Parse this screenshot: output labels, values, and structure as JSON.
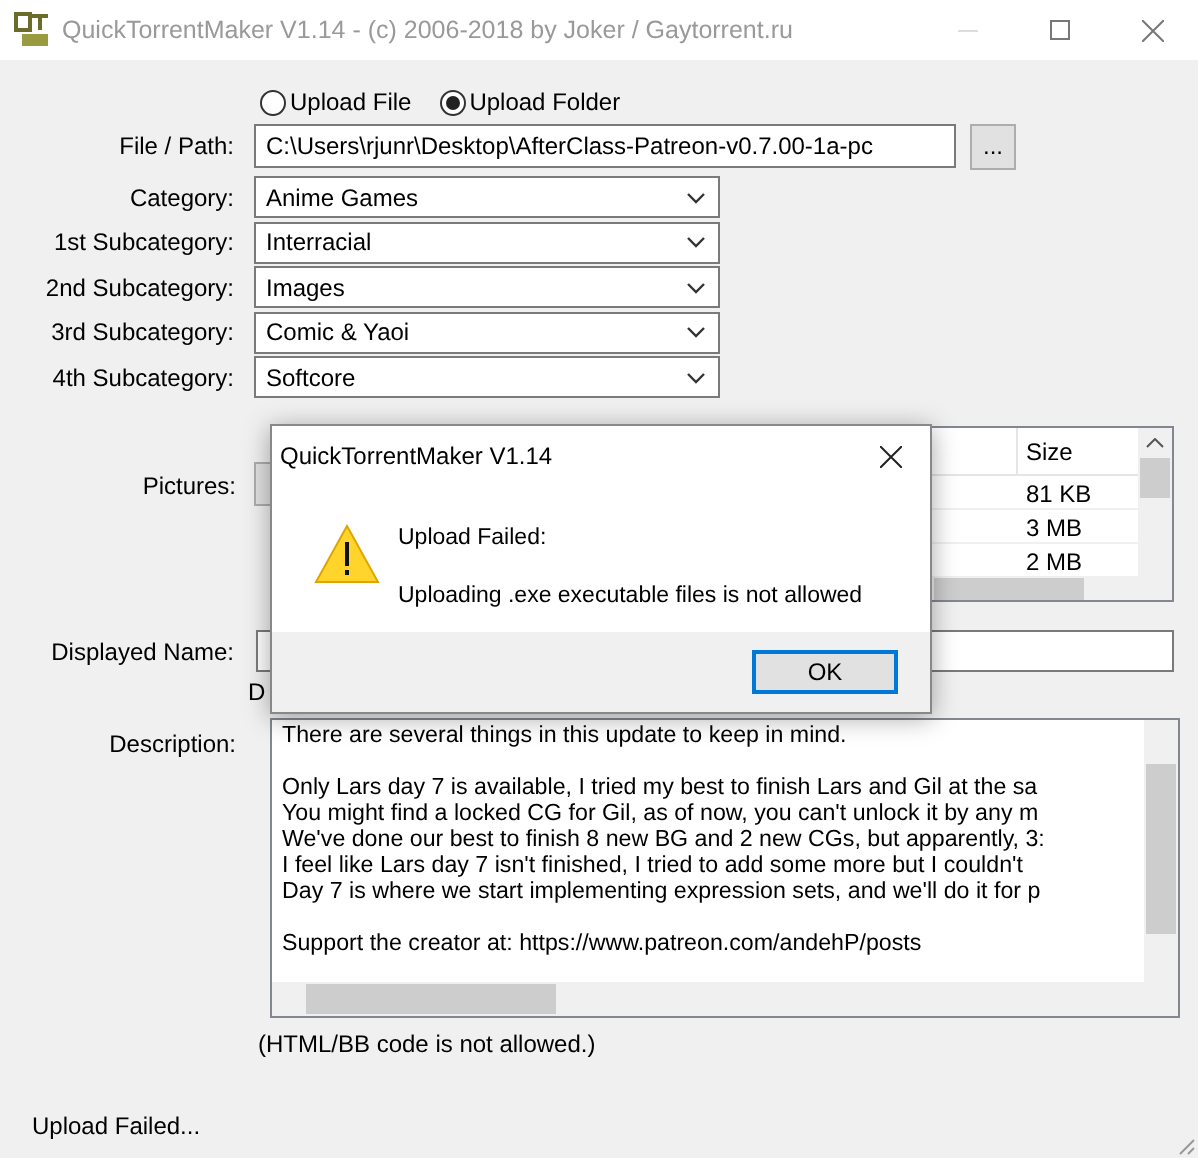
{
  "window": {
    "title": "QuickTorrentMaker V1.14 - (c) 2006-2018 by Joker / Gaytorrent.ru"
  },
  "upload_mode": [
    {
      "label": "Upload File",
      "selected": false
    },
    {
      "label": "Upload Folder",
      "selected": true
    }
  ],
  "path": {
    "label": "File / Path:",
    "value": "C:\\Users\\rjunr\\Desktop\\AfterClass-Patreon-v0.7.00-1a-pc",
    "browse": "..."
  },
  "categories": [
    {
      "label": "Category:",
      "value": "Anime Games"
    },
    {
      "label": "1st Subcategory:",
      "value": "Interracial"
    },
    {
      "label": "2nd Subcategory:",
      "value": "Images"
    },
    {
      "label": "3rd Subcategory:",
      "value": "Comic & Yaoi"
    },
    {
      "label": "4th Subcategory:",
      "value": "Softcore"
    }
  ],
  "pictures": {
    "label": "Pictures:",
    "columns": [
      "Size"
    ],
    "rows": [
      {
        "size": "81 KB"
      },
      {
        "size": "3 MB"
      },
      {
        "size": "2 MB"
      }
    ]
  },
  "displayed_name": {
    "label": "Displayed Name:",
    "note": "D"
  },
  "description": {
    "label": "Description:",
    "paragraphs": [
      [
        "There are several things in this update to keep in mind."
      ],
      [
        "Only Lars day 7 is available, I tried my best to finish Lars and Gil at the sa",
        "You might find a locked CG for Gil, as of now, you can't unlock it by any m",
        "We've done our best to finish 8 new BG and 2 new CGs, but apparently, 3:",
        "I feel like Lars day 7 isn't finished, I tried to add some more but I couldn't",
        "Day 7 is where we start implementing expression sets, and we'll do it for p"
      ],
      [
        "Support the creator at: https://www.patreon.com/andehP/posts"
      ]
    ],
    "note": "(HTML/BB code is not allowed.)"
  },
  "status": "Upload Failed...",
  "dialog": {
    "title": "QuickTorrentMaker V1.14",
    "heading": "Upload Failed:",
    "message": "Uploading .exe executable files is not allowed",
    "button": "OK"
  }
}
